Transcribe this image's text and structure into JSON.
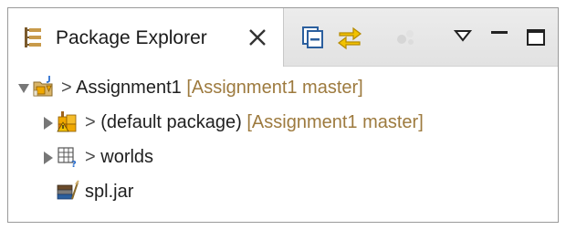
{
  "view": {
    "tab_title": "Package Explorer",
    "tab_icon": "package-explorer-icon",
    "toolbar": [
      {
        "name": "collapse-all-icon",
        "enabled": true
      },
      {
        "name": "link-with-editor-icon",
        "enabled": true
      },
      {
        "name": "focus-on-active-task-icon",
        "enabled": false
      },
      {
        "name": "view-menu-icon",
        "enabled": true
      },
      {
        "name": "minimize-icon",
        "enabled": true
      },
      {
        "name": "maximize-icon",
        "enabled": true
      }
    ]
  },
  "tree": [
    {
      "depth": 0,
      "expanded": true,
      "has_children": true,
      "icon": "java-project-icon",
      "prefix": ">",
      "label": "Assignment1",
      "decoration": "[Assignment1 master]"
    },
    {
      "depth": 1,
      "expanded": false,
      "has_children": true,
      "icon": "default-package-icon",
      "prefix": ">",
      "label": "(default package)",
      "decoration": "[Assignment1 master]"
    },
    {
      "depth": 1,
      "expanded": false,
      "has_children": true,
      "icon": "folder-untracked-icon",
      "prefix": ">",
      "label": "worlds",
      "decoration": ""
    },
    {
      "depth": 1,
      "expanded": false,
      "has_children": false,
      "icon": "jar-file-icon",
      "prefix": "",
      "label": "spl.jar",
      "decoration": ""
    }
  ],
  "colors": {
    "decoration": "#9d7a3e",
    "tab_background": "#ffffff",
    "header_background": "#e6e6e6",
    "accent_icon": "#f0a800"
  }
}
